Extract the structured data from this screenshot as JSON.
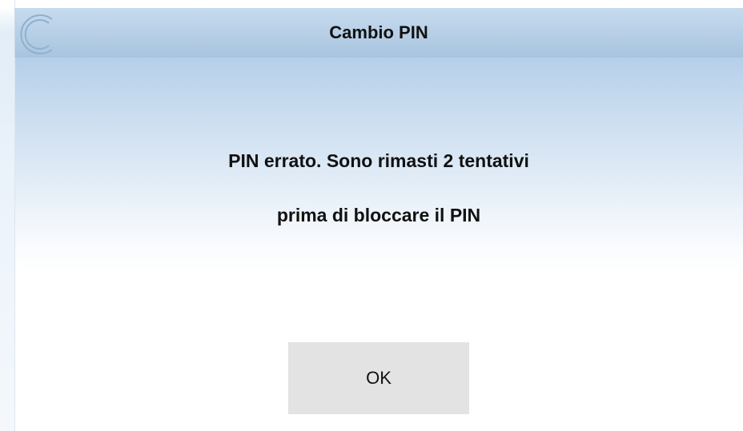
{
  "dialog": {
    "title": "Cambio PIN",
    "logo_icon": "c-logo-icon",
    "message_line_1": "PIN errato. Sono rimasti 2 tentativi",
    "message_line_2": "prima di bloccare il PIN",
    "ok_label": "OK"
  },
  "colors": {
    "titlebar": "#a8c4df",
    "button": "#e3e3e3",
    "text": "#111111"
  }
}
